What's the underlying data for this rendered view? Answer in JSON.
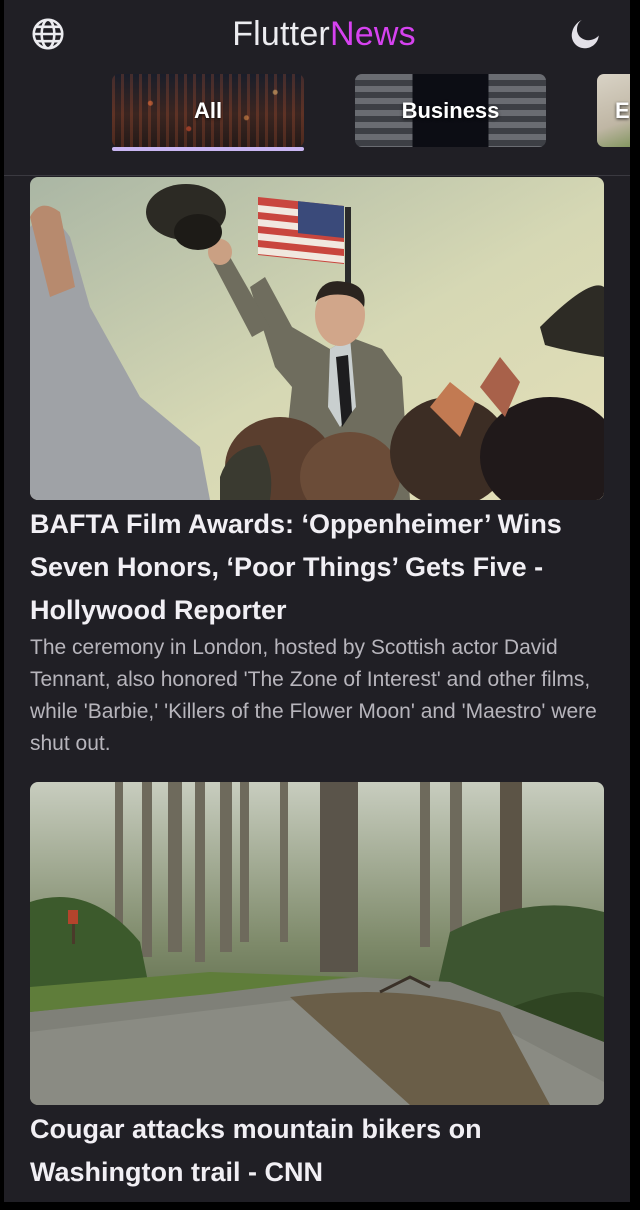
{
  "app": {
    "title_part1": "Flutter",
    "title_part2": "News",
    "accent_color": "#d642f0",
    "left_icon": "globe-icon",
    "right_icon": "theme-toggle-icon"
  },
  "categories": [
    {
      "label": "All",
      "selected": true
    },
    {
      "label": "Business",
      "selected": false
    },
    {
      "label": "E",
      "selected": false
    }
  ],
  "articles": [
    {
      "headline": "BAFTA Film Awards: ‘Oppenheimer’ Wins Seven Honors, ‘Poor Things’ Gets Five - Hollywood Reporter",
      "summary": "The ceremony in London, hosted by Scottish actor David Tennant, also honored 'The Zone of Interest' and other films, while 'Barbie,' 'Killers of the Flower Moon' and 'Maestro' were shut out."
    },
    {
      "headline": "Cougar attacks mountain bikers on Washington trail - CNN",
      "summary": ""
    }
  ]
}
